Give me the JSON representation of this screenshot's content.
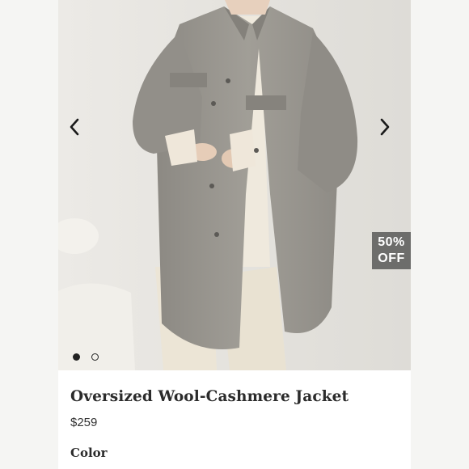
{
  "product": {
    "title": "Oversized Wool-Cashmere Jacket",
    "price": "$259",
    "color_label": "Color"
  },
  "gallery": {
    "badge_line1": "50%",
    "badge_line2": "OFF",
    "image_count": 2,
    "active_index": 0,
    "prev_icon": "chevron-left-icon",
    "next_icon": "chevron-right-icon"
  },
  "colors": {
    "badge_bg": "#6d6d6b",
    "coat": "#9a9790",
    "background": "#e6e4e0",
    "text": "#2b2b2b"
  }
}
